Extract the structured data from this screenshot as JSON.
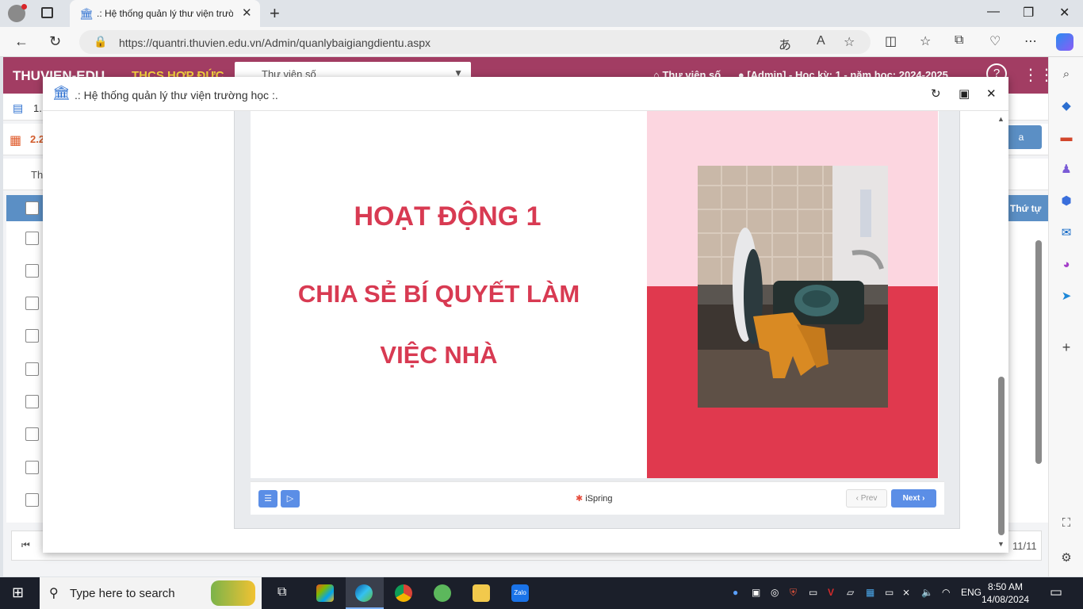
{
  "browser": {
    "tab_title": ".: Hệ thống quản lý thư viện trườ",
    "url": "https://quantri.thuvien.edu.vn/Admin/quanlybaigiangdientu.aspx"
  },
  "app": {
    "brand": "THUVIEN-EDU",
    "school": "THCS HỢP ĐỨC",
    "library_select": "Thư viện số",
    "home_link": "Thư viện số",
    "user_info": "[Admin] - Học kỳ: 1 - năm học: 2024-2025",
    "crumb1": "1.",
    "crumb2": "2.2",
    "toolbar_text": "Th",
    "grid_col_order": "Thứ tự",
    "btn_partial": "a",
    "pager_text": "11/11"
  },
  "modal": {
    "title": ".: Hệ thống quản lý thư viện trường học :."
  },
  "slide": {
    "heading": "HOẠT ĐỘNG 1",
    "subtitle_line1": "CHIA SẺ BÍ QUYẾT LÀM",
    "subtitle_line2": "VIỆC NHÀ",
    "colors": {
      "title": "#d83a52",
      "pink": "#fcd6e0",
      "red": "#e0394e"
    }
  },
  "player": {
    "brand": "iSpring",
    "prev_label": "Prev",
    "next_label": "Next"
  },
  "taskbar": {
    "search_placeholder": "Type here to search",
    "lang": "ENG",
    "time": "8:50 AM",
    "date": "14/08/2024"
  }
}
